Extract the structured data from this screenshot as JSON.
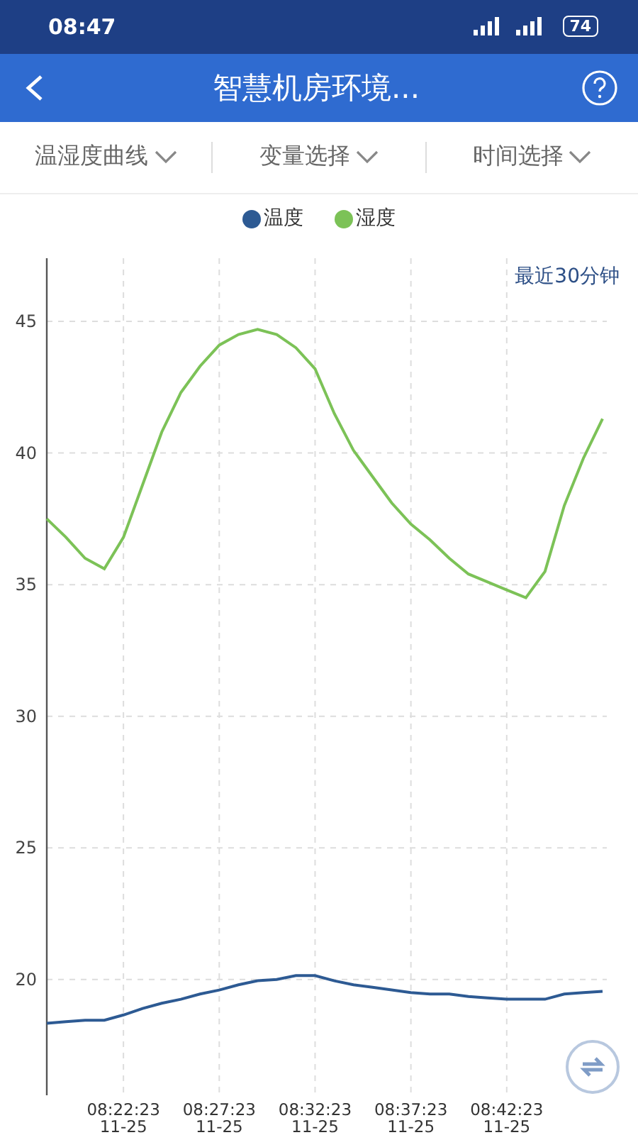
{
  "status_bar": {
    "time": "08:47",
    "battery": "74"
  },
  "header": {
    "title": "智慧机房环境..."
  },
  "filters": [
    {
      "label": "温湿度曲线"
    },
    {
      "label": "变量选择"
    },
    {
      "label": "时间选择"
    }
  ],
  "chart_data": {
    "type": "line",
    "title": "最近30分钟",
    "categories": [
      null,
      null,
      null,
      null,
      "08:22:23 11-25",
      null,
      null,
      null,
      null,
      "08:27:23 11-25",
      null,
      null,
      null,
      null,
      "08:32:23 11-25",
      null,
      null,
      null,
      null,
      "08:37:23 11-25",
      null,
      null,
      null,
      null,
      "08:42:23 11-25",
      null,
      null,
      null,
      null,
      null
    ],
    "series": [
      {
        "name": "温度",
        "color": "#2d5a93",
        "values": [
          18.33,
          18.4,
          18.45,
          18.45,
          18.65,
          18.9,
          19.1,
          19.25,
          19.45,
          19.6,
          19.8,
          19.95,
          20.0,
          20.15,
          20.15,
          19.95,
          19.8,
          19.7,
          19.6,
          19.5,
          19.45,
          19.45,
          19.35,
          19.3,
          19.25,
          19.25,
          19.25,
          19.45,
          19.5,
          19.55
        ]
      },
      {
        "name": "湿度",
        "color": "#7cc257",
        "values": [
          37.5,
          36.8,
          36.0,
          35.6,
          36.8,
          38.8,
          40.8,
          42.3,
          43.3,
          44.1,
          44.5,
          44.7,
          44.5,
          44.0,
          43.2,
          41.5,
          40.1,
          39.1,
          38.1,
          37.3,
          36.7,
          36.0,
          35.4,
          35.1,
          34.8,
          34.5,
          35.5,
          38.0,
          39.8,
          41.3
        ]
      }
    ],
    "grid": true,
    "ylim": [
      15.6,
      47.4
    ],
    "yticks": [
      20,
      25,
      30,
      35,
      40,
      45
    ]
  }
}
